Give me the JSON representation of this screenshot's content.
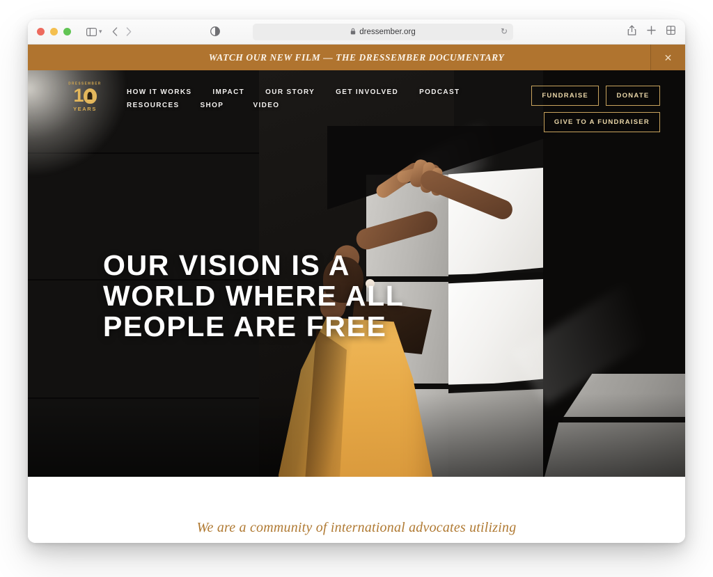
{
  "browser": {
    "traffic_lights": [
      "close",
      "minimize",
      "zoom"
    ],
    "sidebar_label": "sidebar-toggle",
    "back_label": "‹",
    "forward_label": "›",
    "reader_label": "reader-view",
    "url": "dressember.org",
    "lock": "🔒",
    "reload": "⟳",
    "share": "share",
    "new_tab": "+",
    "tab_overview": "tab-overview"
  },
  "announcement": {
    "text": "WATCH OUR NEW FILM — THE DRESSEMBER DOCUMENTARY",
    "close_label": "✕",
    "background": "#b0742f"
  },
  "header": {
    "logo": {
      "arc_text": "DRESSEMBER",
      "number": "1",
      "years": "YEARS"
    },
    "nav": [
      {
        "label": "HOW IT WORKS"
      },
      {
        "label": "IMPACT"
      },
      {
        "label": "OUR STORY"
      },
      {
        "label": "GET INVOLVED"
      },
      {
        "label": "PODCAST"
      },
      {
        "label": "RESOURCES"
      },
      {
        "label": "SHOP"
      },
      {
        "label": "VIDEO"
      }
    ],
    "actions": {
      "fundraise": "FUNDRAISE",
      "donate": "DONATE",
      "give_to_a_fundraiser": "GIVE TO A FUNDRAISER"
    },
    "accent_gold": "#c9a45e"
  },
  "hero": {
    "headline_lines": [
      "OUR VISION IS A",
      "WORLD WHERE ALL",
      "PEOPLE ARE FREE"
    ]
  },
  "intro": {
    "text": "We are a community of international advocates utilizing"
  }
}
